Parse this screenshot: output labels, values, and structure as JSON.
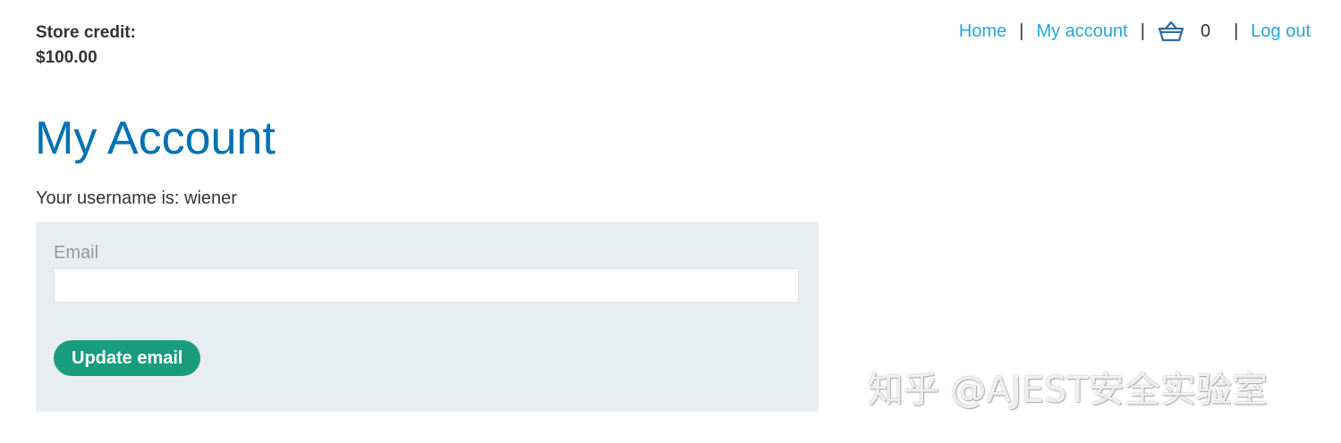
{
  "store_credit": {
    "label": "Store credit:",
    "amount": "$100.00"
  },
  "nav": {
    "home": "Home",
    "separator": "|",
    "my_account": "My account",
    "cart_icon": "basket-icon",
    "cart_count": "0",
    "log_out": "Log out"
  },
  "main": {
    "title": "My Account",
    "username_line": "Your username is: wiener"
  },
  "form": {
    "email_label": "Email",
    "email_value": "",
    "update_button": "Update email"
  },
  "watermark": "知乎 @AJEST安全实验室",
  "colors": {
    "link": "#29a5d8",
    "title": "#0071b3",
    "button": "#1a9c7e",
    "panel": "#e8eef0"
  }
}
